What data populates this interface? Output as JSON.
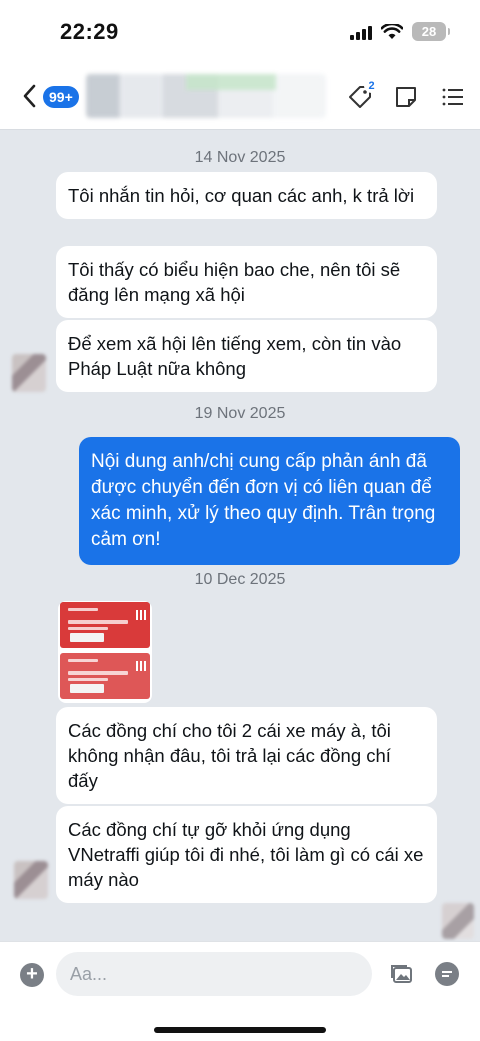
{
  "status_bar": {
    "time": "22:29",
    "battery": "28"
  },
  "header": {
    "unread_badge": "99+",
    "tag_count": "2"
  },
  "messages": [
    {
      "date": "14 Nov 2025"
    },
    {
      "text": "Tôi nhắn tin hỏi, cơ quan các anh, k trả lời"
    },
    {
      "text": "Tôi thấy có biểu hiện bao che, nên tôi sẽ đăng lên mạng xã hội"
    },
    {
      "text": "Để xem xã hội lên tiếng xem, còn tin vào Pháp Luật nữa không"
    },
    {
      "date": "19 Nov 2025"
    },
    {
      "text": "Nội dung anh/chị cung cấp phản ánh đã được chuyển đến đơn vị có liên quan để xác minh, xử lý theo quy định. Trân trọng cảm ơn!"
    },
    {
      "date": "10 Dec 2025"
    },
    {
      "text": "Các đồng chí cho tôi 2 cái xe máy à, tôi không nhận đâu, tôi trả lại các đồng chí đấy"
    },
    {
      "text": "Các đồng chí tự gỡ khỏi ứng dụng VNetraffi giúp tôi đi nhé, tôi làm gì có cái xe máy nào"
    }
  ],
  "image_cards": [
    {
      "title": "CHỨNG NHẬN ĐĂNG KÝ XE MÁY ĐIỆN TỬ",
      "plate": "3681-1"
    },
    {
      "title": "CHỨNG NHẬN ĐĂNG KÝ XE MÁY ĐIỆN TỬ",
      "plate": "3684-83"
    }
  ],
  "composer": {
    "placeholder": "Aa..."
  },
  "colors": {
    "accent": "#1a73e8",
    "background": "#e3e7ec",
    "card_red": "#d93a3a"
  }
}
